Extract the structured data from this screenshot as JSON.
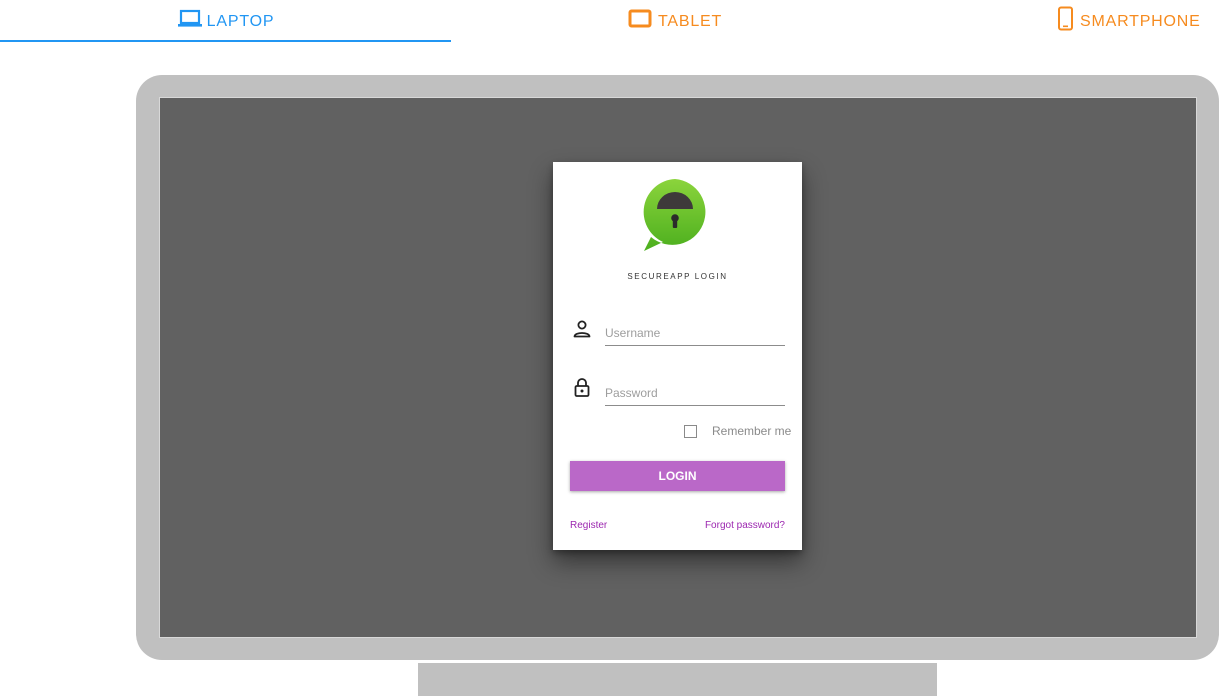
{
  "colors": {
    "laptop_tab": "#2196f3",
    "tablet_tab": "#f68b1f",
    "phone_tab": "#f68b1f",
    "underline": "#2196f3",
    "accent": "#ba68c8",
    "link": "#9c27b0",
    "logo_green_light": "#8bd43c",
    "logo_green_dark": "#4caf1e"
  },
  "tabs": [
    {
      "label": "LAPTOP",
      "icon": "laptop-icon",
      "active": true
    },
    {
      "label": "TABLET",
      "icon": "tablet-icon",
      "active": false
    },
    {
      "label": "SMARTPHONE",
      "icon": "smartphone-icon",
      "active": false
    }
  ],
  "login": {
    "logo_icon": "lock-chat-bubble-icon",
    "title": "SECUREAPP LOGIN",
    "username_placeholder": "Username",
    "username_icon": "user-icon",
    "password_placeholder": "Password",
    "password_icon": "lock-icon",
    "remember_label": "Remember me",
    "remember_checked": false,
    "login_button": "LOGIN",
    "register_link": "Register",
    "forgot_link": "Forgot password?"
  }
}
